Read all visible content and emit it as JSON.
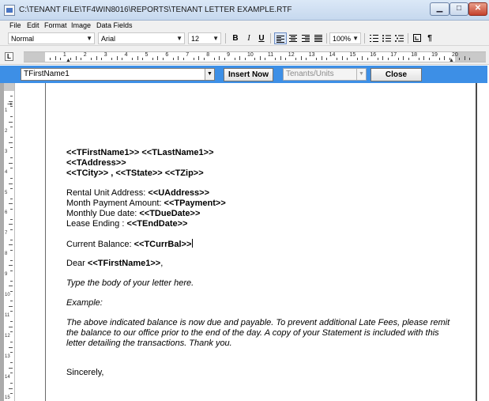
{
  "window": {
    "title": "C:\\TENANT FILE\\TF4WIN8016\\REPORTS\\TENANT LETTER EXAMPLE.RTF",
    "minimize_glyph": "▁",
    "maximize_glyph": "□",
    "close_glyph": "✕"
  },
  "menu": {
    "items": [
      "File",
      "Edit",
      "Format",
      "Image",
      "Data Fields"
    ]
  },
  "toolbar": {
    "style_value": "Normal",
    "font_value": "Arial",
    "size_value": "12",
    "bold": "B",
    "italic": "I",
    "underline": "U",
    "zoom_value": "100%",
    "pilcrow": "¶",
    "combo_arrow": "▼"
  },
  "ruler": {
    "numbers": [
      "1",
      "2",
      "3",
      "4",
      "5",
      "6",
      "7",
      "8",
      "9",
      "10",
      "11",
      "12",
      "13",
      "14",
      "15",
      "16",
      "17",
      "18",
      "19",
      "20"
    ],
    "tab_selector": "L",
    "vertical_numbers": [
      "1",
      "2",
      "3",
      "4",
      "5",
      "6",
      "7",
      "8",
      "9",
      "10",
      "11",
      "12",
      "13",
      "14",
      "15"
    ]
  },
  "fieldbar": {
    "field_value": "TFirstName1",
    "insert_label": "Insert Now",
    "tenants_value": "Tenants/Units",
    "close_label": "Close"
  },
  "document": {
    "name_line": "<<TFirstName1>> <<TLastName1>>",
    "address_line": "<<TAddress>>",
    "city_line": "<<TCity>> , <<TState>> <<TZip>>",
    "rental_label": "Rental Unit Address: ",
    "rental_value": "<<UAddress>>",
    "payment_label": "Month Payment Amount: ",
    "payment_value": "<<TPayment>>",
    "due_label": "Monthly Due date: ",
    "due_value": "<<TDueDate>>",
    "lease_label": "Lease Ending :  ",
    "lease_value": "<<TEndDate>>",
    "balance_label": "Current Balance: ",
    "balance_value": "<<TCurrBal>>",
    "dear_label": "Dear ",
    "dear_value": "<<TFirstName1>>",
    "dear_suffix": ",",
    "body_prompt": "Type the body of your letter here.",
    "example_label": "Example:",
    "paragraph": "The above indicated balance is now  due and payable.  To prevent additional Late Fees, please remit the balance to our office prior to the end of the day.  A copy of your Statement is included with this letter detailing the transactions.  Thank you.",
    "closing": "Sincerely,"
  }
}
